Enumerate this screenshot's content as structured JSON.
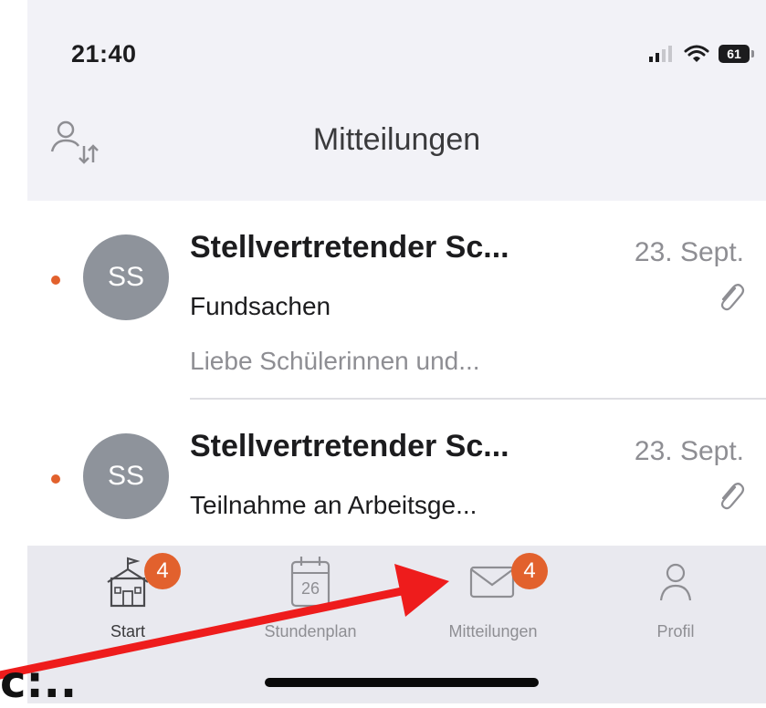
{
  "status_bar": {
    "time": "21:40",
    "battery": "61"
  },
  "nav": {
    "title": "Mitteilungen"
  },
  "messages": [
    {
      "avatar": "SS",
      "sender": "Stellvertretender Sc...",
      "date": "23. Sept.",
      "subject": "Fundsachen",
      "preview": "Liebe Schülerinnen und...",
      "unread": true,
      "has_attachment": true
    },
    {
      "avatar": "SS",
      "sender": "Stellvertretender Sc...",
      "date": "23. Sept.",
      "subject": "Teilnahme an Arbeitsge...",
      "preview": "",
      "unread": true,
      "has_attachment": true
    }
  ],
  "tabs": [
    {
      "label": "Start",
      "icon": "school-icon",
      "badge": "4"
    },
    {
      "label": "Stundenplan",
      "icon": "calendar-icon",
      "calendar_day": "26"
    },
    {
      "label": "Mitteilungen",
      "icon": "envelope-icon",
      "badge": "4"
    },
    {
      "label": "Profil",
      "icon": "person-icon"
    }
  ],
  "annotation": {
    "text": "c:.."
  },
  "colors": {
    "accent": "#e2612d",
    "avatar": "#8e939b",
    "arrow": "#ee1c1c",
    "background": "#f2f2f7"
  }
}
